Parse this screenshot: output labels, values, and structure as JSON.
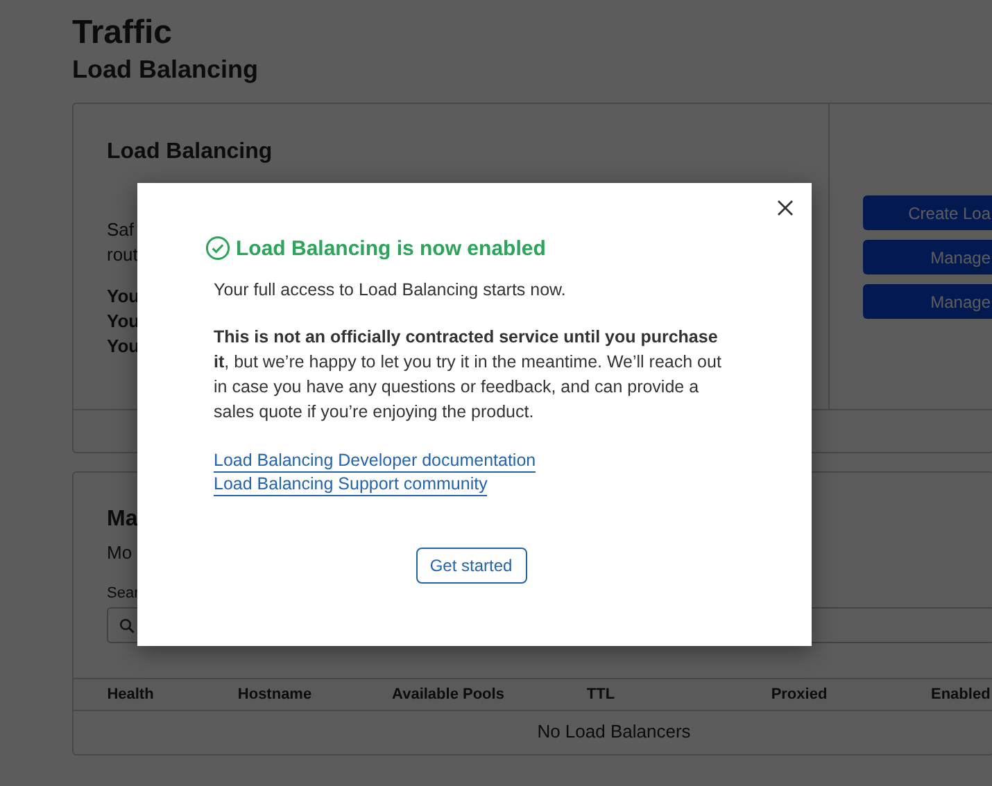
{
  "page": {
    "title": "Traffic",
    "subtitle": "Load Balancing"
  },
  "status_card": {
    "heading": "Load Balancing",
    "description_lines": [
      "Saf",
      "rout"
    ],
    "notes": [
      "You",
      "You",
      "You"
    ],
    "buttons": [
      {
        "label": "Create Loa"
      },
      {
        "label": "Manage"
      },
      {
        "label": "Manage"
      }
    ]
  },
  "manage_card": {
    "heading": "Ma",
    "description": "Mo",
    "search_label": "Sear",
    "table": {
      "columns": [
        "Health",
        "Hostname",
        "Available Pools",
        "TTL",
        "Proxied",
        "Enabled"
      ],
      "empty_message": "No Load Balancers"
    }
  },
  "dialog": {
    "title": "Load Balancing is now enabled",
    "intro": "Your full access to Load Balancing starts now.",
    "body": "**This is not an officially contracted service until you purchase it**, but we’re happy to let you try it in the meantime. We’ll reach out in case you have any questions or feedback, and can provide a sales quote if you’re enjoying the product.",
    "links": [
      "Load Balancing Developer documentation",
      "Load Balancing Support community"
    ],
    "button": "Get started"
  }
}
